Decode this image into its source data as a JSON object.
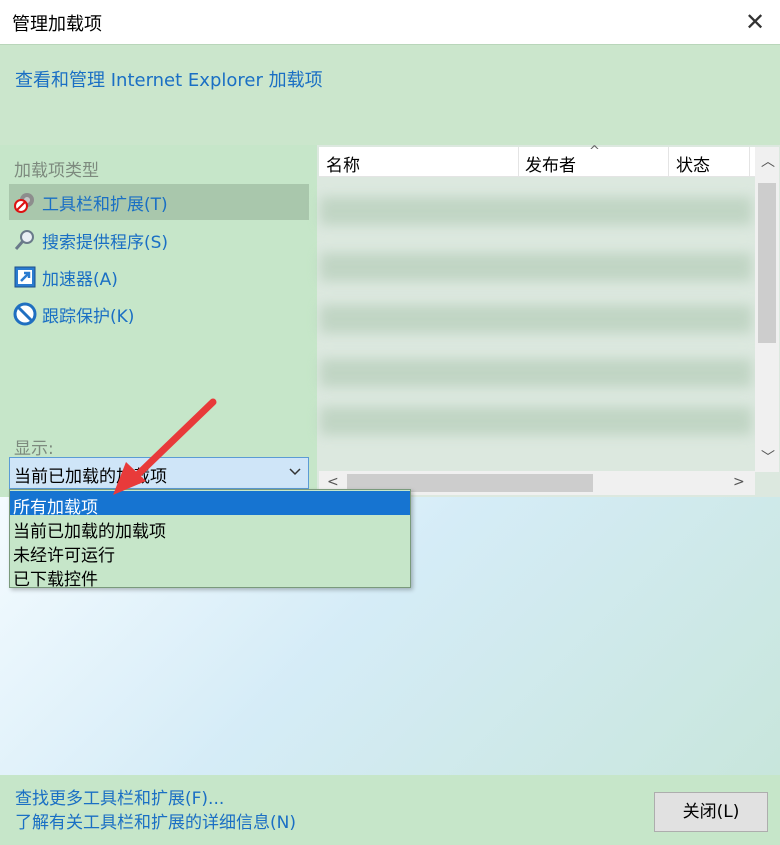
{
  "window": {
    "title": "管理加载项"
  },
  "header": {
    "text": "查看和管理 Internet Explorer 加载项"
  },
  "sidebar": {
    "type_label": "加载项类型",
    "items": [
      {
        "label": "工具栏和扩展(T)",
        "icon": "gear-blocked-icon",
        "selected": true
      },
      {
        "label": "搜索提供程序(S)",
        "icon": "magnifier-icon",
        "selected": false
      },
      {
        "label": "加速器(A)",
        "icon": "accelerator-icon",
        "selected": false
      },
      {
        "label": "跟踪保护(K)",
        "icon": "no-entry-icon",
        "selected": false
      }
    ],
    "show_label": "显示:",
    "show_value": "当前已加载的加载项"
  },
  "dropdown": {
    "options": [
      "所有加载项",
      "当前已加载的加载项",
      "未经许可运行",
      "已下载控件"
    ],
    "highlighted": 0
  },
  "list": {
    "columns": [
      "名称",
      "发布者",
      "状态"
    ]
  },
  "footer": {
    "link1": "查找更多工具栏和扩展(F)...",
    "link2": "了解有关工具栏和扩展的详细信息(N)",
    "close_label": "关闭(L)"
  },
  "colors": {
    "accent": "#1674d1",
    "panel": "#c6e6c9",
    "link": "#1a6fc4"
  }
}
